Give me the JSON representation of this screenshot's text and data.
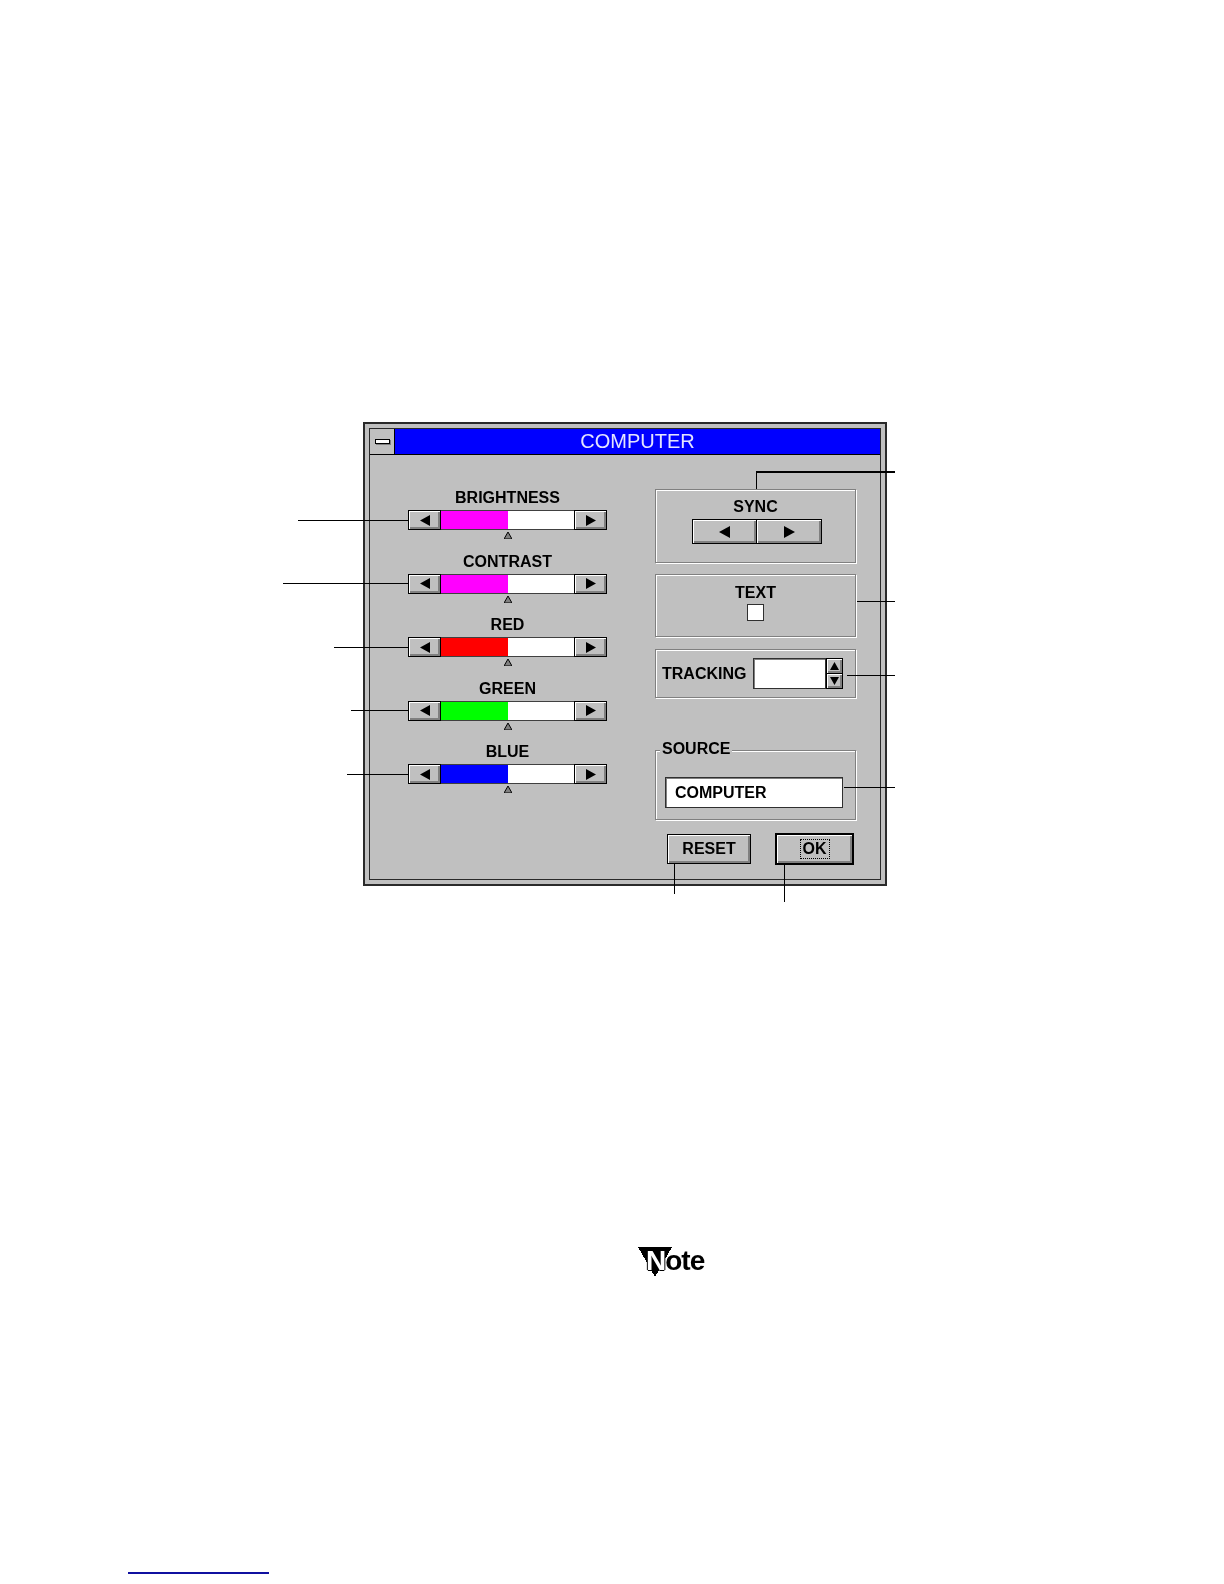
{
  "window": {
    "title": "COMPUTER"
  },
  "sliders": [
    {
      "label": "BRIGHTNESS",
      "color": "#ff00ff",
      "level": 0.5
    },
    {
      "label": "CONTRAST",
      "color": "#ff00ff",
      "level": 0.5
    },
    {
      "label": "RED",
      "color": "#ff0000",
      "level": 0.5
    },
    {
      "label": "GREEN",
      "color": "#00ff00",
      "level": 0.5
    },
    {
      "label": "BLUE",
      "color": "#0000ff",
      "level": 0.5
    }
  ],
  "sync": {
    "label": "SYNC"
  },
  "text_option": {
    "label": "TEXT",
    "checked": false
  },
  "tracking": {
    "label": "TRACKING"
  },
  "source": {
    "label": "SOURCE",
    "value": "COMPUTER"
  },
  "buttons": [
    {
      "label": "RESET",
      "default": false
    },
    {
      "label": "OK",
      "default": true
    }
  ],
  "note": {
    "text": "Note"
  }
}
